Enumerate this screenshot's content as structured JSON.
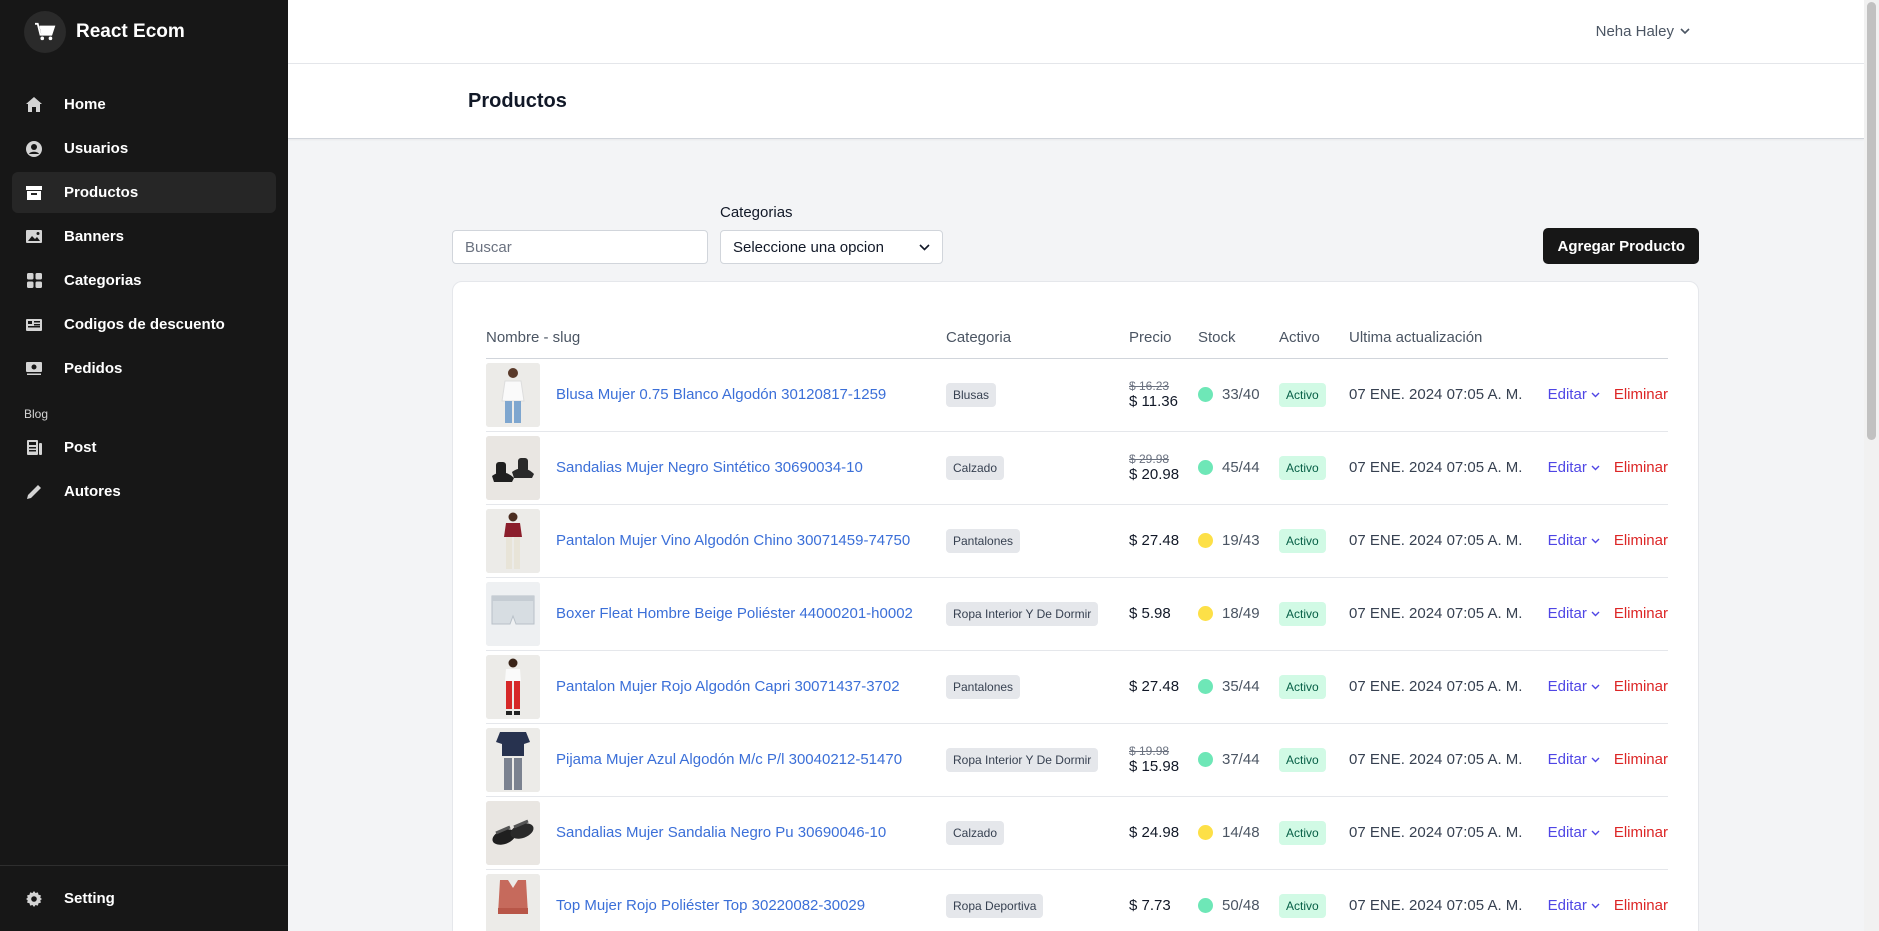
{
  "app": {
    "title": "React Ecom"
  },
  "sidebar": {
    "items": [
      {
        "label": "Home",
        "icon": "home-icon"
      },
      {
        "label": "Usuarios",
        "icon": "user-circle-icon"
      },
      {
        "label": "Productos",
        "icon": "archive-box-icon"
      },
      {
        "label": "Banners",
        "icon": "image-icon"
      },
      {
        "label": "Categorias",
        "icon": "grid-icon"
      },
      {
        "label": "Codigos de descuento",
        "icon": "discount-icon"
      },
      {
        "label": "Pedidos",
        "icon": "cash-icon"
      }
    ],
    "blog_section": "Blog",
    "blog_items": [
      {
        "label": "Post",
        "icon": "post-icon"
      },
      {
        "label": "Autores",
        "icon": "pencil-icon"
      }
    ],
    "setting": {
      "label": "Setting",
      "icon": "gear-icon"
    }
  },
  "header": {
    "user_name": "Neha Haley"
  },
  "page": {
    "title": "Productos"
  },
  "filters": {
    "search_placeholder": "Buscar",
    "category_label": "Categorias",
    "category_value": "Seleccione una opcion",
    "add_button": "Agregar Producto"
  },
  "table": {
    "headers": [
      "Nombre - slug",
      "Categoria",
      "Precio",
      "Stock",
      "Activo",
      "Ultima actualización"
    ],
    "edit_label": "Editar",
    "delete_label": "Eliminar",
    "rows": [
      {
        "name": "Blusa Mujer 0.75 Blanco Algodón 30120817-1259",
        "category": "Blusas",
        "old_price": "$ 16.23",
        "price": "$ 11.36",
        "stock": "33/40",
        "stock_status": "green",
        "active": "Activo",
        "updated": "07 ENE. 2024 07:05 A. M.",
        "thumb": "blouse"
      },
      {
        "name": "Sandalias Mujer Negro Sintético 30690034-10",
        "category": "Calzado",
        "old_price": "$ 29.98",
        "price": "$ 20.98",
        "stock": "45/44",
        "stock_status": "green",
        "active": "Activo",
        "updated": "07 ENE. 2024 07:05 A. M.",
        "thumb": "sandal"
      },
      {
        "name": "Pantalon Mujer Vino Algodón Chino 30071459-74750",
        "category": "Pantalones",
        "old_price": "",
        "price": "$ 27.48",
        "stock": "19/43",
        "stock_status": "yellow",
        "active": "Activo",
        "updated": "07 ENE. 2024 07:05 A. M.",
        "thumb": "pants-wine"
      },
      {
        "name": "Boxer Fleat Hombre Beige Poliéster 44000201-h0002",
        "category": "Ropa Interior Y De Dormir",
        "old_price": "",
        "price": "$ 5.98",
        "stock": "18/49",
        "stock_status": "yellow",
        "active": "Activo",
        "updated": "07 ENE. 2024 07:05 A. M.",
        "thumb": "boxer"
      },
      {
        "name": "Pantalon Mujer Rojo Algodón Capri 30071437-3702",
        "category": "Pantalones",
        "old_price": "",
        "price": "$ 27.48",
        "stock": "35/44",
        "stock_status": "green",
        "active": "Activo",
        "updated": "07 ENE. 2024 07:05 A. M.",
        "thumb": "pants-red"
      },
      {
        "name": "Pijama Mujer Azul Algodón M/c P/l 30040212-51470",
        "category": "Ropa Interior Y De Dormir",
        "old_price": "$ 19.98",
        "price": "$ 15.98",
        "stock": "37/44",
        "stock_status": "green",
        "active": "Activo",
        "updated": "07 ENE. 2024 07:05 A. M.",
        "thumb": "pajama"
      },
      {
        "name": "Sandalias Mujer Sandalia Negro Pu 30690046-10",
        "category": "Calzado",
        "old_price": "",
        "price": "$ 24.98",
        "stock": "14/48",
        "stock_status": "yellow",
        "active": "Activo",
        "updated": "07 ENE. 2024 07:05 A. M.",
        "thumb": "sandal2"
      },
      {
        "name": "Top Mujer Rojo Poliéster Top 30220082-30029",
        "category": "Ropa Deportiva",
        "old_price": "",
        "price": "$ 7.73",
        "stock": "50/48",
        "stock_status": "green",
        "active": "Activo",
        "updated": "07 ENE. 2024 07:05 A. M.",
        "thumb": "top"
      }
    ]
  }
}
